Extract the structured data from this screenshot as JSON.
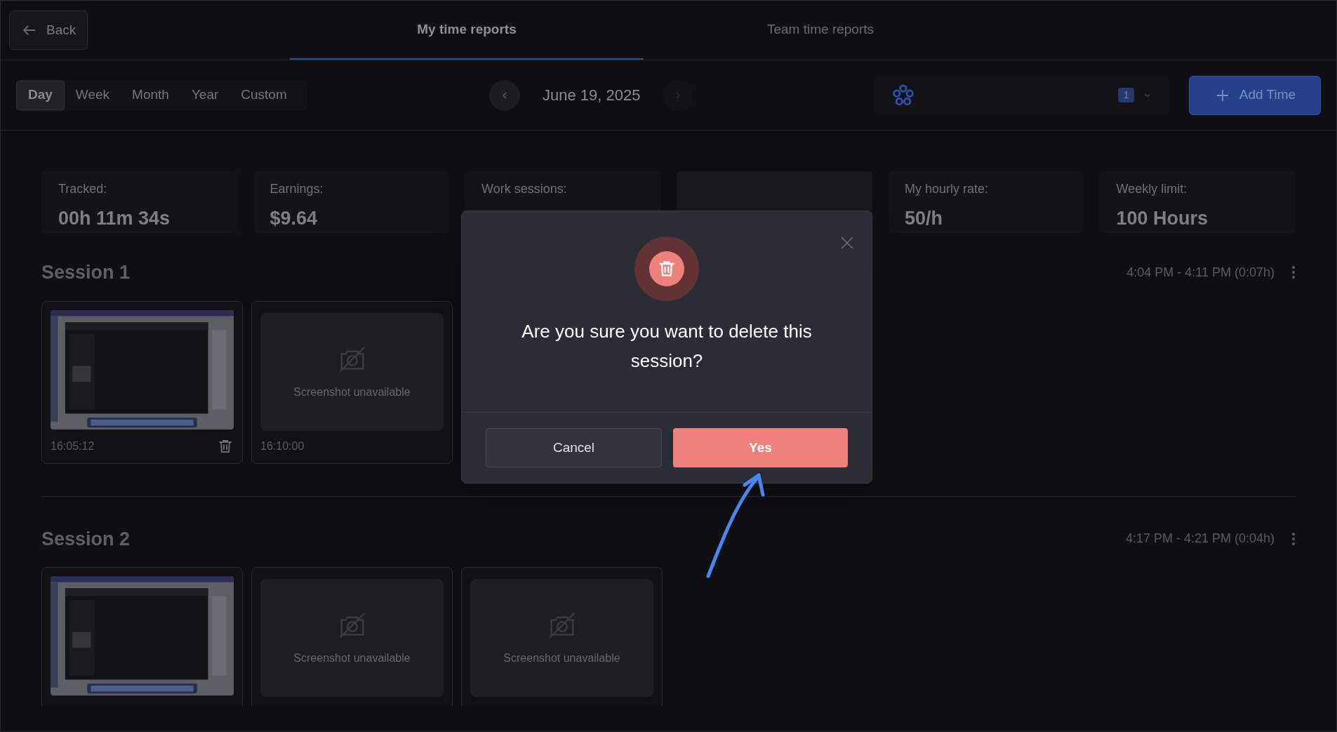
{
  "back_button": "Back",
  "tabs": [
    {
      "label": "My time reports",
      "selected": true
    },
    {
      "label": "Team time reports",
      "selected": false
    }
  ],
  "periods": [
    {
      "label": "Day",
      "selected": true
    },
    {
      "label": "Week",
      "selected": false
    },
    {
      "label": "Month",
      "selected": false
    },
    {
      "label": "Year",
      "selected": false
    },
    {
      "label": "Custom",
      "selected": false
    }
  ],
  "date": "June 19, 2025",
  "team_filter": {
    "badge": "1"
  },
  "add_button": "Add Time",
  "stats": [
    {
      "kind": "stat",
      "label": "Tracked:",
      "value": "00h 11m 34s"
    },
    {
      "kind": "stat",
      "label": "Earnings:",
      "value": "$9.64"
    },
    {
      "kind": "stat",
      "label": "Work sessions:"
    },
    {
      "kind": "blank"
    },
    {
      "kind": "stat",
      "label": "My hourly rate:",
      "value": "50/h"
    },
    {
      "kind": "stat",
      "label": "Weekly limit:",
      "value": "100 Hours"
    }
  ],
  "sessions": [
    {
      "title": "Session 1",
      "time": "4:04 PM - 4:11 PM (0:07h)",
      "shots": [
        {
          "kind": "picture",
          "time": "16:05:12",
          "deletable": true
        },
        {
          "kind": "unavailable",
          "caption": "Screenshot unavailable",
          "time": "16:10:00",
          "deletable": false
        }
      ]
    },
    {
      "title": "Session 2",
      "time": "4:17 PM - 4:21 PM (0:04h)",
      "shots": [
        {
          "kind": "picture"
        },
        {
          "kind": "unavailable",
          "caption": "Screenshot unavailable"
        },
        {
          "kind": "unavailable",
          "caption": "Screenshot unavailable"
        }
      ]
    }
  ],
  "dialog": {
    "message": "Are you sure you want to delete this session?",
    "buttons": [
      {
        "label": "Cancel",
        "kind": "secondary"
      },
      {
        "label": "Yes",
        "kind": "danger"
      }
    ]
  }
}
